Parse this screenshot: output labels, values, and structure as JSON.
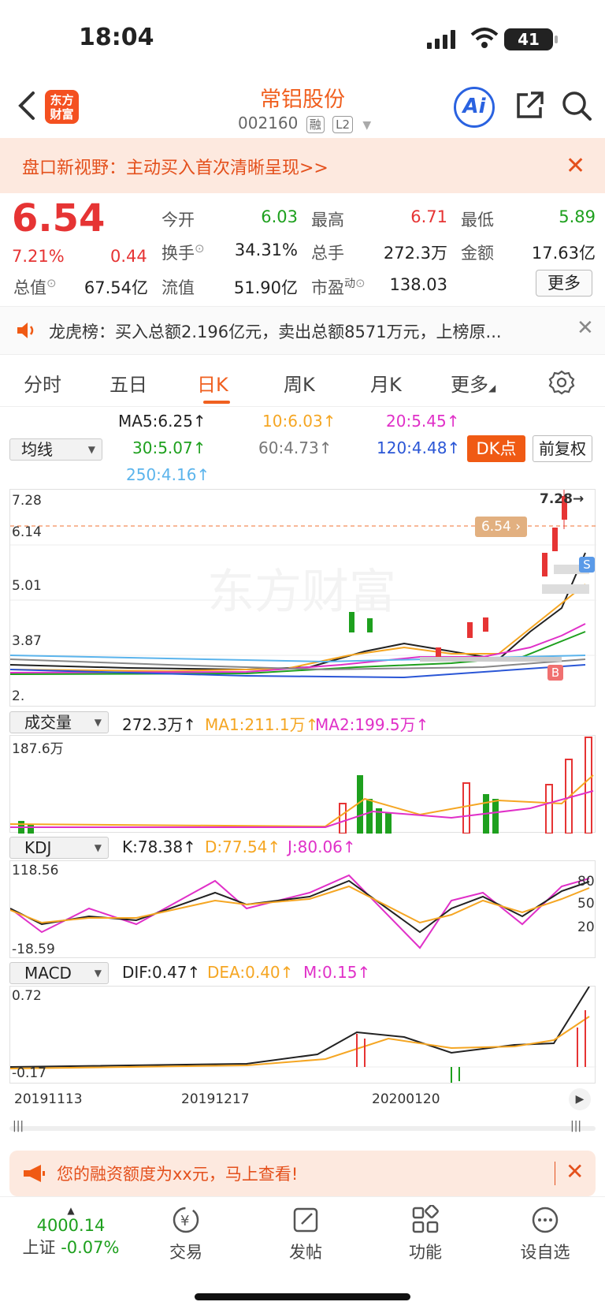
{
  "status_bar": {
    "time": "18:04",
    "battery": "41"
  },
  "header": {
    "logo_line1": "东方",
    "logo_line2": "财富",
    "stock_name": "常铝股份",
    "stock_code": "002160",
    "tag_rong": "融",
    "tag_l2": "L2",
    "ai_label": "Ai"
  },
  "banner": {
    "text": "盘口新视野：主动买入首次清晰呈现>>"
  },
  "quote": {
    "price": "6.54",
    "change_pct": "7.21%",
    "change_amt": "0.44",
    "open_label": "今开",
    "open": "6.03",
    "high_label": "最高",
    "high": "6.71",
    "low_label": "最低",
    "low": "5.89",
    "turnover_label": "换手",
    "turnover": "34.31%",
    "volume_label": "总手",
    "volume": "272.3万",
    "amount_label": "金额",
    "amount": "17.63亿",
    "mktcap_label": "总值",
    "mktcap": "67.54亿",
    "float_label": "流值",
    "float_cap": "51.90亿",
    "pe_label": "市盈",
    "pe_sup": "动",
    "pe": "138.03",
    "more_label": "更多"
  },
  "lhb": {
    "text": "龙虎榜：买入总额2.196亿元，卖出总额8571万元，上榜原..."
  },
  "tabs": [
    "分时",
    "五日",
    "日K",
    "周K",
    "月K",
    "更多"
  ],
  "ma": {
    "select_label": "均线",
    "ma5": "MA5:6.25↑",
    "ma10": "10:6.03↑",
    "ma20": "20:5.45↑",
    "ma30": "30:5.07↑",
    "ma60": "60:4.73↑",
    "ma120": "120:4.48↑",
    "ma250": "250:4.16↑",
    "dk_label": "DK点",
    "fq_label": "前复权"
  },
  "kline": {
    "y_labels": [
      "7.28",
      "6.14",
      "5.01",
      "3.87"
    ],
    "high_marker": "7.28→",
    "price_tag": "6.54",
    "bottom_partial": "2.",
    "watermark": "东方财富",
    "b_marker": "B",
    "s_marker": "S"
  },
  "volume": {
    "select_label": "成交量",
    "vol": "272.3万↑",
    "ma1": "MA1:211.1万↑",
    "ma2": "MA2:199.5万↑",
    "max_label": "187.6万"
  },
  "kdj": {
    "select_label": "KDJ",
    "k": "K:78.38↑",
    "d": "D:77.54↑",
    "j": "J:80.06↑",
    "top": "118.56",
    "bottom": "-18.59",
    "levels": [
      "80",
      "50",
      "20"
    ]
  },
  "macd": {
    "select_label": "MACD",
    "dif": "DIF:0.47↑",
    "dea": "DEA:0.40↑",
    "m": "M:0.15↑",
    "top": "0.72",
    "bottom": "-0.17"
  },
  "dates": [
    "20191113",
    "20191217",
    "20200120"
  ],
  "promo": {
    "text": "您的融资额度为xx元，马上查看!"
  },
  "bottom_nav": {
    "index_value": "4000.14",
    "index_name": "上证",
    "index_change": "-0.07%",
    "trade": "交易",
    "post": "发帖",
    "function": "功能",
    "watchlist": "设自选"
  },
  "colors": {
    "up": "#e63434",
    "down": "#1ea01e",
    "accent": "#f06020"
  }
}
